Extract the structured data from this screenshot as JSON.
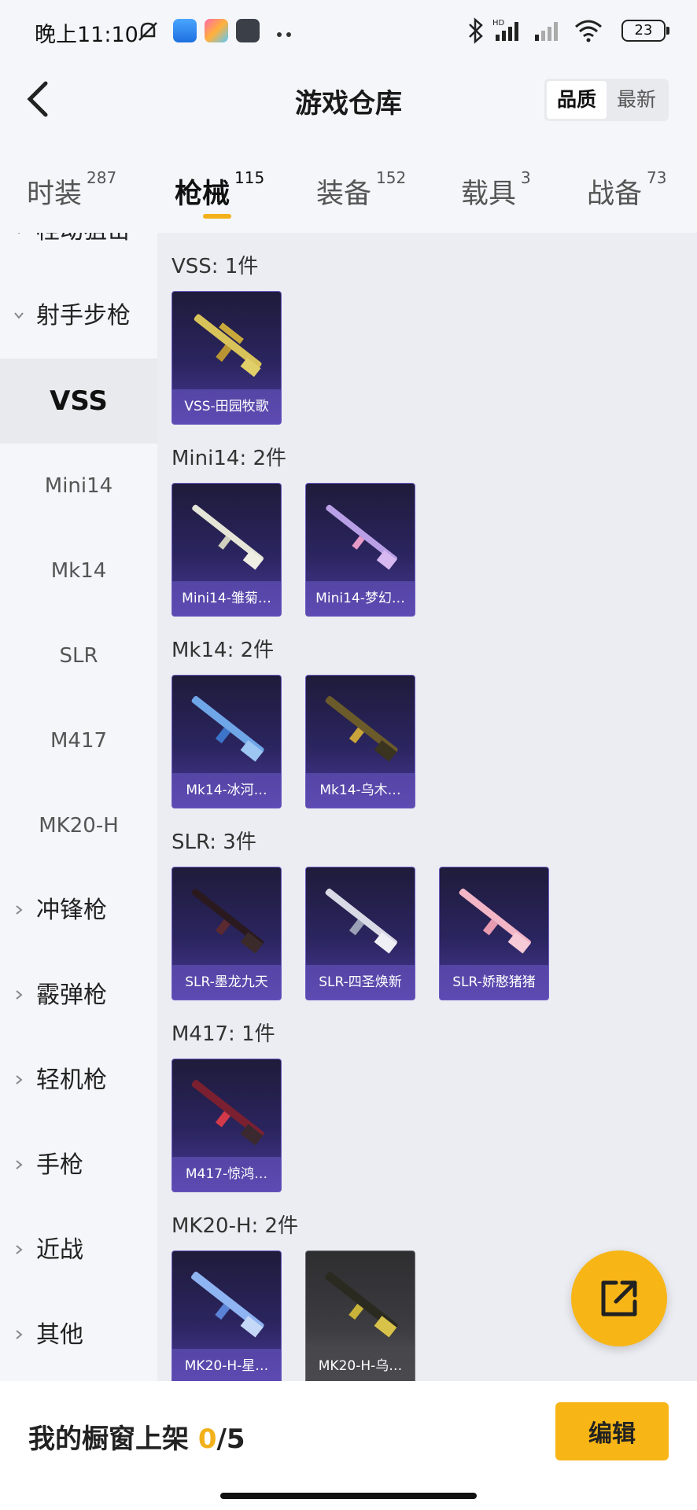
{
  "status_bar": {
    "time": "晚上11:10",
    "battery": "23"
  },
  "header": {
    "title": "游戏仓库",
    "sort_options": [
      "品质",
      "最新"
    ],
    "active_sort": "品质"
  },
  "tabs": [
    {
      "label": "时装",
      "count": "287"
    },
    {
      "label": "枪械",
      "count": "115"
    },
    {
      "label": "装备",
      "count": "152"
    },
    {
      "label": "载具",
      "count": "3"
    },
    {
      "label": "战备",
      "count": "73"
    }
  ],
  "active_tab": "枪械",
  "sidebar": {
    "partial_top": "栓动狙击",
    "group_open": "射手步枪",
    "subitems": [
      "VSS",
      "Mini14",
      "Mk14",
      "SLR",
      "M417",
      "MK20-H"
    ],
    "selected": "VSS",
    "groups": [
      "冲锋枪",
      "霰弹枪",
      "轻机枪",
      "手枪",
      "近战",
      "其他"
    ]
  },
  "sections": [
    {
      "label": "VSS: 1件",
      "items": [
        "VSS-田园牧歌"
      ]
    },
    {
      "label": "Mini14: 2件",
      "items": [
        "Mini14-雏菊…",
        "Mini14-梦幻…"
      ]
    },
    {
      "label": "Mk14: 2件",
      "items": [
        "Mk14-冰河…",
        "Mk14-乌木…"
      ]
    },
    {
      "label": "SLR: 3件",
      "items": [
        "SLR-墨龙九天",
        "SLR-四圣焕新",
        "SLR-娇憨猪猪"
      ]
    },
    {
      "label": "M417: 1件",
      "items": [
        "M417-惊鸿…"
      ]
    },
    {
      "label": "MK20-H: 2件",
      "items": [
        "MK20-H-星…",
        "MK20-H-乌…"
      ]
    }
  ],
  "colors": {
    "accent": "#f7b516",
    "card_purple": "#2b2560",
    "card_gray": "#3d3d42"
  },
  "bottom_bar": {
    "showcase_label": "我的橱窗上架",
    "showcase_current": "0",
    "showcase_total": "/5",
    "edit_label": "编辑"
  }
}
